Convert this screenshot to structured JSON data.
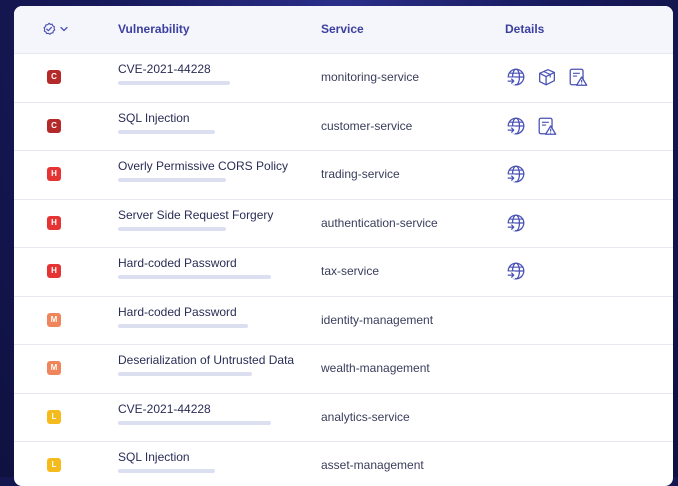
{
  "colors": {
    "critical": "#b42a2a",
    "high": "#e53434",
    "medium": "#f0845a",
    "low": "#f5bb1c",
    "header_text": "#3b3fa0",
    "icon_stroke": "#4a52b5"
  },
  "table": {
    "headers": {
      "vulnerability": "Vulnerability",
      "service": "Service",
      "details": "Details"
    },
    "rows": [
      {
        "severity": "C",
        "vulnerability": "CVE-2021-44228",
        "service": "monitoring-service",
        "icons": [
          "globe-arrow-icon",
          "package-icon",
          "alert-document-icon"
        ]
      },
      {
        "severity": "C",
        "vulnerability": "SQL Injection",
        "service": "customer-service",
        "icons": [
          "globe-arrow-icon",
          "alert-document-icon"
        ]
      },
      {
        "severity": "H",
        "vulnerability": "Overly Permissive CORS Policy",
        "service": "trading-service",
        "icons": [
          "globe-arrow-icon"
        ]
      },
      {
        "severity": "H",
        "vulnerability": "Server Side Request Forgery",
        "service": "authentication-service",
        "icons": [
          "globe-arrow-icon"
        ]
      },
      {
        "severity": "H",
        "vulnerability": "Hard-coded Password",
        "service": "tax-service",
        "icons": [
          "globe-arrow-icon"
        ]
      },
      {
        "severity": "M",
        "vulnerability": "Hard-coded Password",
        "service": "identity-management",
        "icons": []
      },
      {
        "severity": "M",
        "vulnerability": "Deserialization of Untrusted Data",
        "service": "wealth-management",
        "icons": []
      },
      {
        "severity": "L",
        "vulnerability": "CVE-2021-44228",
        "service": "analytics-service",
        "icons": []
      },
      {
        "severity": "L",
        "vulnerability": "SQL Injection",
        "service": "asset-management",
        "icons": []
      }
    ]
  }
}
